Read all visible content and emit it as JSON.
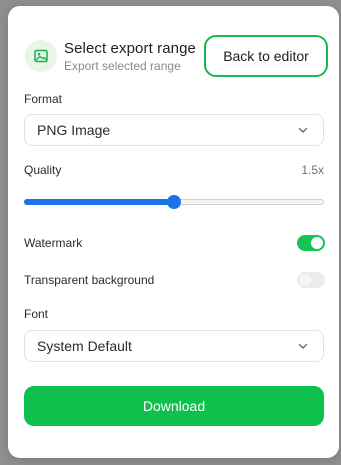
{
  "header": {
    "title": "Select export range",
    "subtitle": "Export selected range",
    "icon": "image-icon",
    "back_label": "Back to editor"
  },
  "format": {
    "label": "Format",
    "selected": "PNG Image"
  },
  "quality": {
    "label": "Quality",
    "value_text": "1.5x",
    "fraction": 0.5
  },
  "watermark": {
    "label": "Watermark",
    "enabled": true
  },
  "transparent_background": {
    "label": "Transparent background",
    "enabled": false
  },
  "font": {
    "label": "Font",
    "selected": "System Default"
  },
  "download_label": "Download",
  "colors": {
    "accent_green": "#0fc04d",
    "slider_blue": "#1a73e8",
    "toggle_on": "#16c454"
  }
}
